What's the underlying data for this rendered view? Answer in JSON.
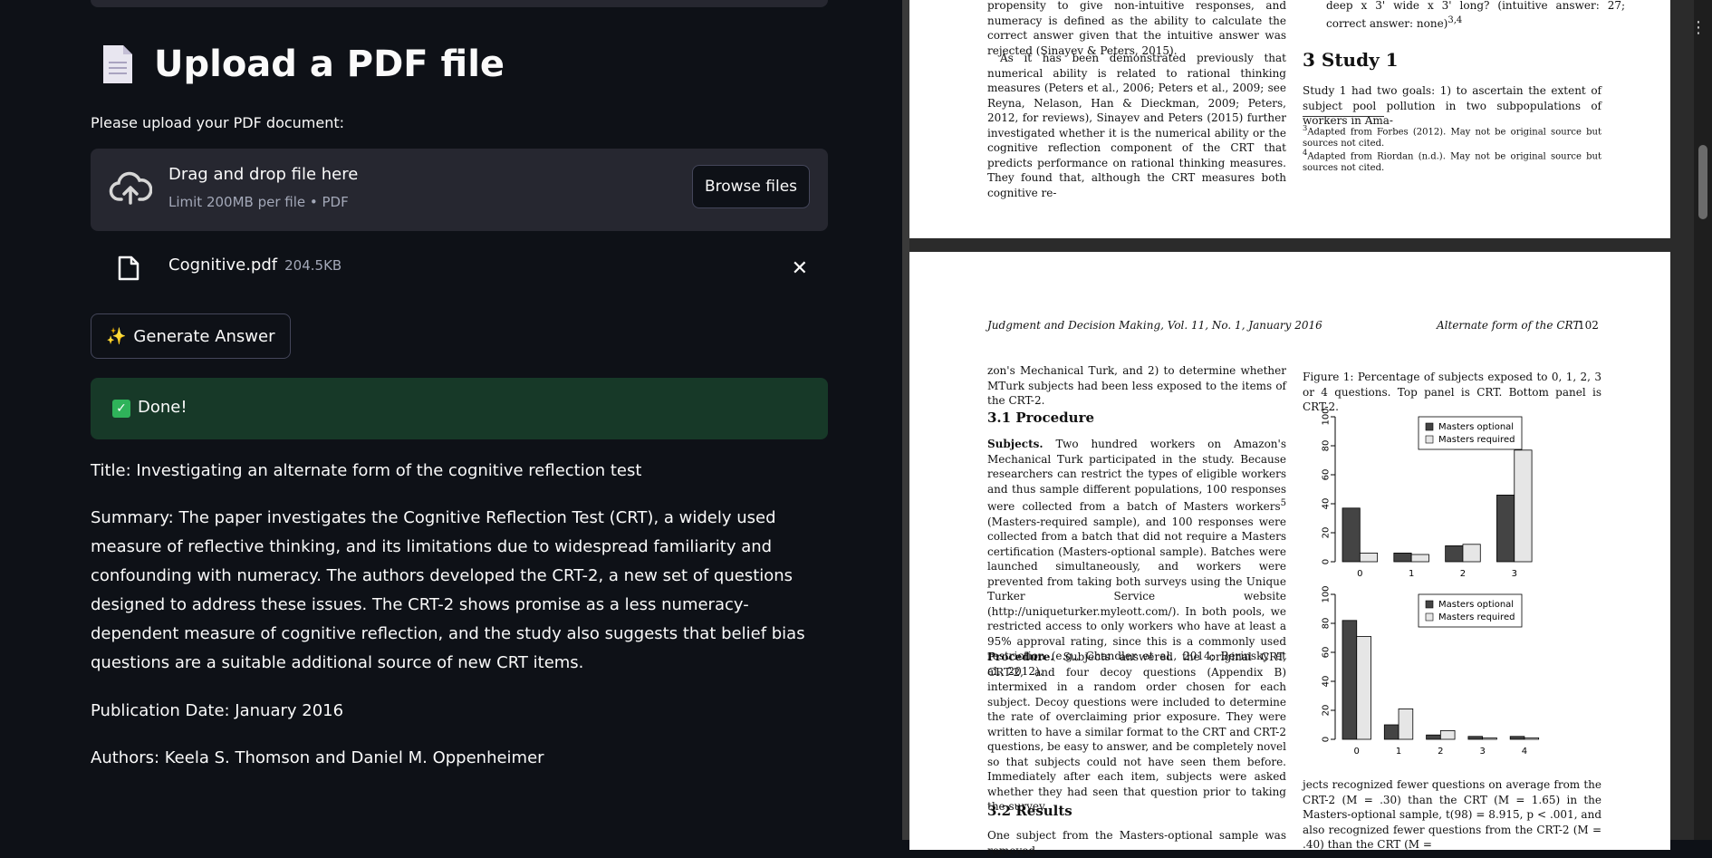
{
  "left": {
    "title": "Upload a PDF file",
    "prompt": "Please upload your PDF document:",
    "dropzone": {
      "title": "Drag and drop file here",
      "subtitle": "Limit 200MB per file • PDF",
      "browse_label": "Browse files"
    },
    "file": {
      "name": "Cognitive.pdf",
      "size": "204.5KB"
    },
    "generate_label": "Generate Answer",
    "done_label": "Done!",
    "output": {
      "title": "Title: Investigating an alternate form of the cognitive reflection test",
      "summary": "Summary: The paper investigates the Cognitive Reflection Test (CRT), a widely used measure of reflective thinking, and its limitations due to widespread familiarity and confounding with numeracy. The authors developed the CRT-2, a new set of questions designed to address these issues. The CRT-2 shows promise as a less numeracy-dependent measure of cognitive reflection, and the study also suggests that belief bias questions are a suitable additional source of new CRT items.",
      "date": "Publication Date: January 2016",
      "authors": "Authors: Keela S. Thomson and Daniel M. Oppenheimer"
    }
  },
  "pdf": {
    "page1": {
      "left_top": "propensity to give non-intuitive responses, and numeracy is defined as the ability to calculate the correct answer given that the intuitive answer was rejected (Sinayev & Peters, 2015).",
      "left_para": "As it has been demonstrated previously that numerical ability is related to rational thinking measures (Peters et al., 2006; Peters et al., 2009; see Reyna, Nelason, Han & Dieckman, 2009; Peters, 2012, for reviews), Sinayev and Peters (2015) further investigated whether it is the numerical ability or the cognitive reflection component of the CRT that predicts performance on rational thinking measures. They found that, although the CRT measures both cognitive re-",
      "right_top": "deep x 3' wide x 3' long? (intuitive answer: 27; correct answer: none)",
      "right_top_sup": "3,4",
      "section": "3   Study 1",
      "study_text": "Study 1 had two goals: 1) to ascertain the extent of subject pool pollution in two subpopulations of workers in Ama-",
      "fn3": "Adapted from Forbes (2012). May not be original source but sources not cited.",
      "fn3_mark": "3",
      "fn4": "Adapted from Riordan (n.d.). May not be original source but sources not cited.",
      "fn4_mark": "4"
    },
    "page2": {
      "header_left": "Judgment and Decision Making, Vol. 11, No. 1, January 2016",
      "header_right": "Alternate form of the CRT",
      "page_num": "102",
      "intro": "zon's Mechanical Turk, and 2) to determine whether MTurk subjects had been less exposed to the items of the CRT-2.",
      "sec31": "3.1   Procedure",
      "subjects_label": "Subjects.",
      "subjects_text": "Two hundred workers on Amazon's Mechanical Turk participated in the study. Because researchers can restrict the types of eligible workers and thus sample different populations, 100 responses were collected from a batch of Masters workers",
      "subjects_sup": "5",
      "subjects_text2": "(Masters-required sample), and 100 responses were collected from a batch that did not require a Masters certification (Masters-optional sample). Batches were launched simultaneously, and workers were prevented from taking both surveys using the Unique Turker Service website (http://uniqueturker.myleott.com/). In both pools, we restricted access to only workers who have at least a 95% approval rating, since this is a commonly used restriction (e.g., Chandler et al., 2014; Berinsky et al., 2012).",
      "procedure_label": "Procedure.",
      "procedure_text": "Subjects answered the original CRT, CRT-2, and four decoy questions (Appendix B) intermixed in a random order chosen for each subject. Decoy questions were included to determine the rate of overclaiming prior exposure. They were written to have a similar format to the CRT and CRT-2 questions, be easy to answer, and be completely novel so that subjects could not have seen them before. Immediately after each item, subjects were asked whether they had seen that question prior to taking the survey.",
      "sec32": "3.2   Results",
      "results_text": "One subject from the Masters-optional sample was removed",
      "figure_caption": "Figure 1: Percentage of subjects exposed to 0, 1, 2, 3 or 4 questions. Top panel is CRT. Bottom panel is CRT-2.",
      "right_bottom": "jects recognized fewer questions on average from the CRT-2 (M = .30) than the CRT (M = 1.65) in the Masters-optional sample, t(98) = 8.915, p < .001, and also recognized fewer questions from the CRT-2 (M = .40) than the CRT (M ="
    }
  },
  "chart_data": [
    {
      "type": "bar",
      "title": "",
      "categories": [
        "0",
        "1",
        "2",
        "3"
      ],
      "series": [
        {
          "name": "Masters optional",
          "values": [
            37,
            6,
            11,
            46
          ]
        },
        {
          "name": "Masters required",
          "values": [
            6,
            5,
            12,
            77
          ]
        }
      ],
      "ylim": [
        0,
        100
      ],
      "yticks": [
        "0",
        "20",
        "40",
        "60",
        "80",
        "100"
      ],
      "colors": [
        "#444444",
        "#e6e6e6"
      ],
      "legend": "top-right"
    },
    {
      "type": "bar",
      "title": "",
      "categories": [
        "0",
        "1",
        "2",
        "3",
        "4"
      ],
      "series": [
        {
          "name": "Masters optional",
          "values": [
            82,
            10,
            3,
            2,
            2
          ]
        },
        {
          "name": "Masters required",
          "values": [
            71,
            21,
            6,
            1,
            1
          ]
        }
      ],
      "ylim": [
        0,
        100
      ],
      "yticks": [
        "0",
        "20",
        "40",
        "60",
        "80",
        "100"
      ],
      "colors": [
        "#444444",
        "#e6e6e6"
      ],
      "legend": "top-right"
    }
  ]
}
